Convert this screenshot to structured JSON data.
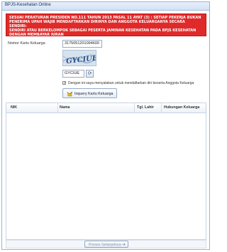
{
  "window": {
    "title": "BPJS-Kesehatan Online"
  },
  "notice": {
    "lines": [
      "SESUAI PERATURAN PRESIDEN NO.111 TAHUN 2013 PASAL 11 AYAT (3) : SETIAP PEKERJA BUKAN",
      "PENERIMA UPAH WAJIB MENDAFTARKAN DIRINYA DAN ANGGOTA KELUARGANYA SECARA SENDIRI-",
      "SENDIRI ATAU BERKELOMPOK SEBAGAI PESERTA JAMINAN KESEHATAN PADA BPJS KESEHATAN",
      "DENGAN MEMBAYAR IURAN"
    ]
  },
  "form": {
    "kk_label": "Nomor Kartu Keluarga",
    "kk_value": "3175051201094600",
    "captcha_text": "GYCIUE",
    "captcha_input_value": "GYCIUE",
    "consent_checked": true,
    "consent_label": "Dengan ini saya menyatakan untuk mendaftarkan diri beserta Anggota Keluarga",
    "inquiry_button": "Inquery Kartu Keluarga"
  },
  "table": {
    "columns": [
      "NIK",
      "Nama",
      "Tgl. Lahir",
      "Hubungan Keluarga"
    ],
    "rows": []
  },
  "footer": {
    "next_button": "Proses Selanjutnya"
  },
  "colors": {
    "notice_bg": "#e02a2a",
    "notice_text": "#ffffff",
    "border": "#98b4d4"
  }
}
